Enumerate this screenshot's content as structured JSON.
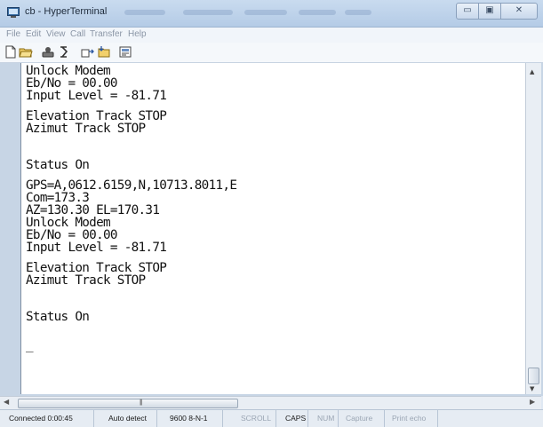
{
  "window": {
    "title": "cb - HyperTerminal",
    "controls": {
      "minimize": "▭",
      "maximize": "▣",
      "close": "✕"
    }
  },
  "menu": [
    "File",
    "Edit",
    "View",
    "Call",
    "Transfer",
    "Help"
  ],
  "toolbar": {
    "icons": [
      "new-connection-icon",
      "open-icon",
      "disconnect-icon",
      "dial-icon",
      "send-icon",
      "receive-icon",
      "properties-icon"
    ]
  },
  "terminal": {
    "lines": [
      "Unlock Modem",
      "Eb/No = 00.00",
      "Input Level = -81.71",
      "",
      "Elevation Track STOP",
      "Azimut Track STOP",
      "",
      "",
      "",
      "Status On",
      "",
      "GPS=A,0612.6159,N,10713.8011,E",
      "Com=173.3",
      "AZ=130.30 EL=170.31",
      "Unlock Modem",
      "Eb/No = 00.00",
      "Input Level = -81.71",
      "",
      "Elevation Track STOP",
      "Azimut Track STOP",
      "",
      "",
      "",
      "Status On",
      "",
      "",
      "_"
    ]
  },
  "statusbar": {
    "connected": "Connected 0:00:45",
    "detect": "Auto detect",
    "settings": "9600 8-N-1",
    "scroll": "SCROLL",
    "caps": "CAPS",
    "num": "NUM",
    "capture": "Capture",
    "print_echo": "Print echo"
  },
  "colors": {
    "titlebar": "#b4cbe6",
    "terminal_bg": "#ffffff",
    "text": "#111111",
    "inactive_indicator": "#9ba6b4"
  }
}
